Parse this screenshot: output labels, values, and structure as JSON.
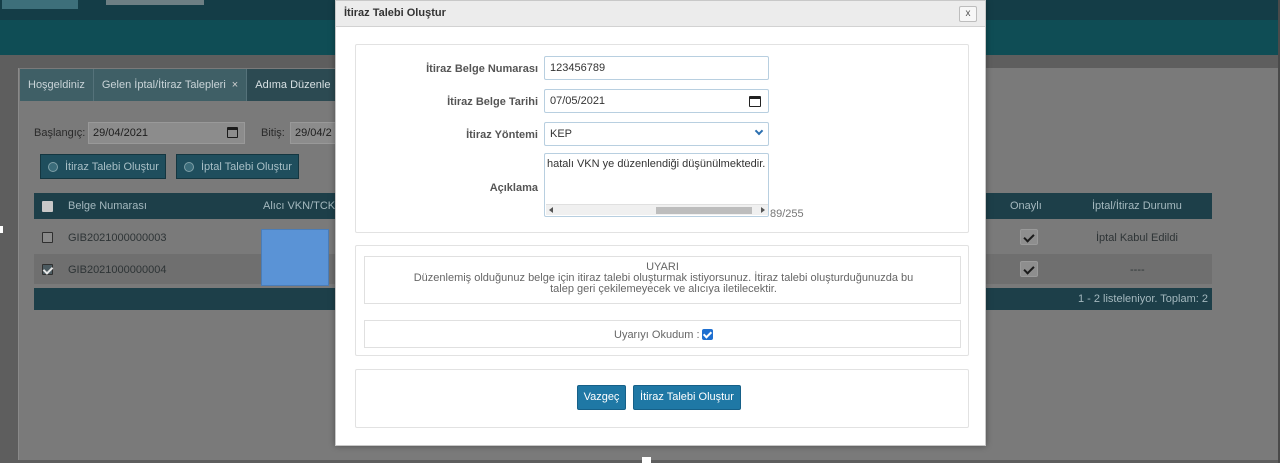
{
  "background": {
    "tabs": [
      {
        "label": "Hoşgeldiniz"
      },
      {
        "label": "Gelen İptal/İtiraz Talepleri",
        "close": "×"
      },
      {
        "label": "Adıma Düzenle"
      }
    ],
    "filters": {
      "start_label": "Başlangıç:",
      "start_value": "29/04/2021",
      "end_label": "Bitiş:",
      "end_value": "29/04/2"
    },
    "buttons": {
      "objection": "İtiraz Talebi Oluştur",
      "cancel": "İptal Talebi Oluştur"
    },
    "table": {
      "headers": {
        "doc_no": "Belge Numarası",
        "receiver": "Alıcı VKN/TCK",
        "approved": "Onaylı",
        "status": "İptal/İtiraz Durumu"
      },
      "rows": [
        {
          "doc_no": "GIB2021000000003",
          "checked": false,
          "status": "İptal Kabul Edildi"
        },
        {
          "doc_no": "GIB2021000000004",
          "checked": true,
          "status": "----"
        }
      ],
      "footer": "1 - 2 listeleniyor. Toplam: 2"
    }
  },
  "modal": {
    "title": "İtiraz Talebi Oluştur",
    "close_label": "x",
    "fields": {
      "doc_no_label": "İtiraz Belge Numarası",
      "doc_no_value": "123456789",
      "doc_date_label": "İtiraz Belge Tarihi",
      "doc_date_value": "07/05/2021",
      "method_label": "İtiraz Yöntemi",
      "method_value": "KEP",
      "description_label": "Açıklama",
      "description_value": "hatalı VKN ye düzenlendiği düşünülmektedir.",
      "char_counter": "89/255"
    },
    "warning": {
      "title": "UYARI",
      "body": "Düzenlemiş olduğunuz belge için itiraz talebi oluşturmak istiyorsunuz. İtiraz talebi oluşturduğunuzda bu talep geri çekilemeyecek ve alıcıya iletilecektir."
    },
    "read_label": "Uyarıyı Okudum :",
    "read_checked": true,
    "actions": {
      "cancel": "Vazgeç",
      "submit": "İtiraz Talebi Oluştur"
    }
  },
  "colors": {
    "primary_button": "#1f78a5",
    "header_band": "#0f4d55",
    "checkbox_blue": "#1e6fd0"
  }
}
